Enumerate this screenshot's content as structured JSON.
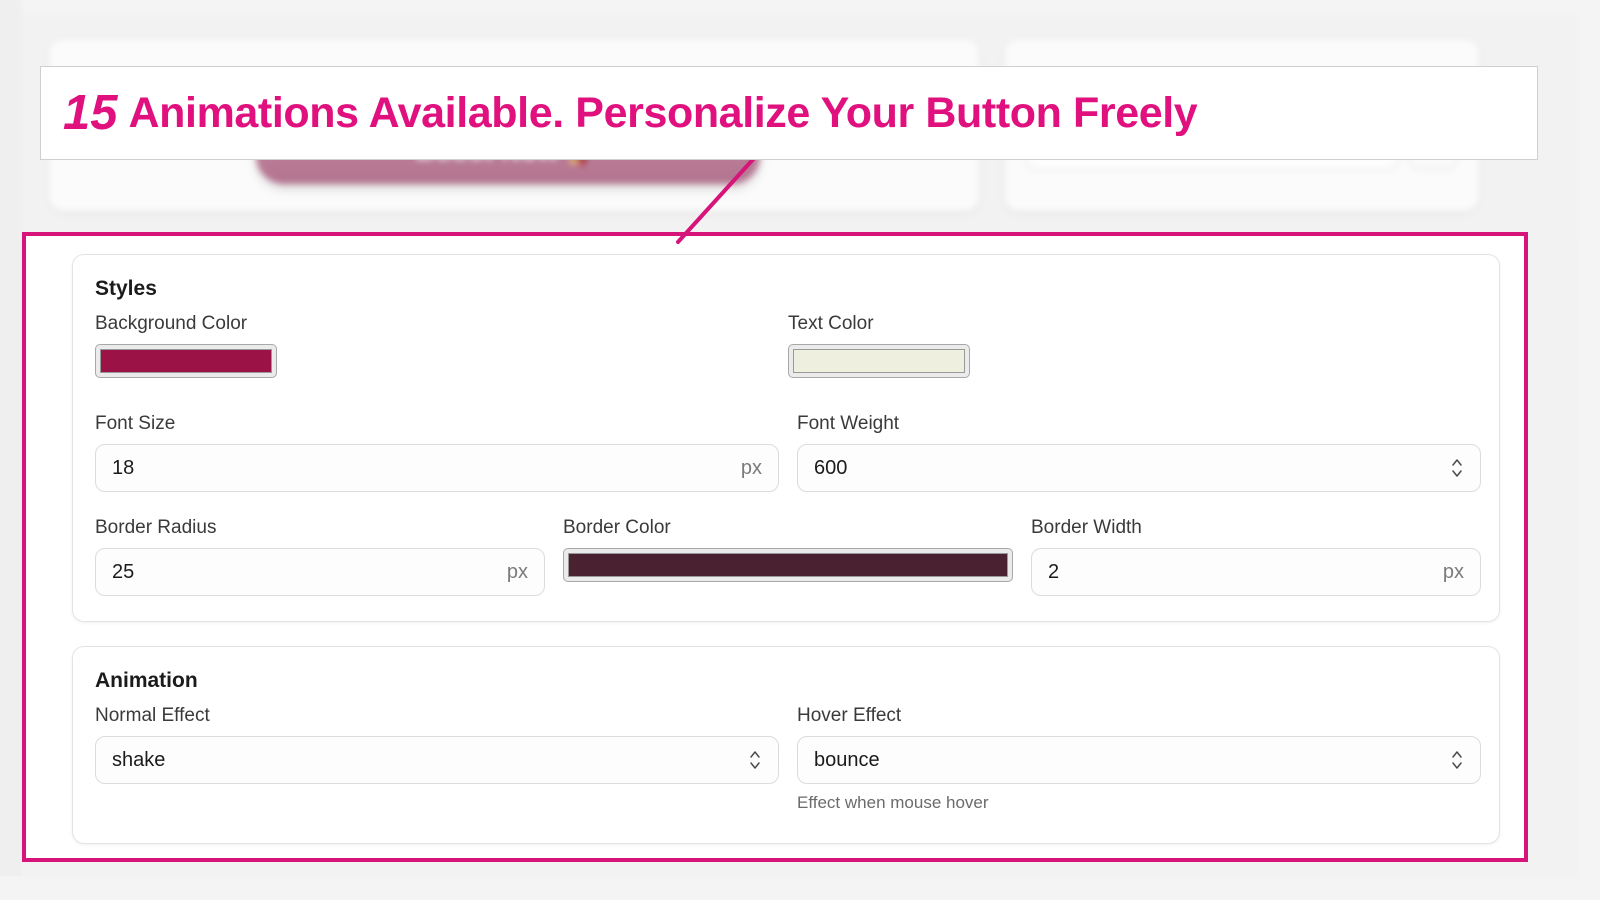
{
  "banner": {
    "number": "15",
    "text": "Animations Available. Personalize Your Button Freely",
    "accent_color": "#e0117e"
  },
  "highlight": {
    "border_color": "#d6147a",
    "arrow_color": "#d6147a"
  },
  "background_app": {
    "preview_button_label": "Boost Now 🚀"
  },
  "styles_card": {
    "title": "Styles",
    "background_color": {
      "label": "Background Color",
      "value": "#9b1246"
    },
    "text_color": {
      "label": "Text Color",
      "value": "#efefdf"
    },
    "font_size": {
      "label": "Font Size",
      "value": "18",
      "suffix": "px"
    },
    "font_weight": {
      "label": "Font Weight",
      "value": "600"
    },
    "border_radius": {
      "label": "Border Radius",
      "value": "25",
      "suffix": "px"
    },
    "border_color": {
      "label": "Border Color",
      "value": "#4a2130"
    },
    "border_width": {
      "label": "Border Width",
      "value": "2",
      "suffix": "px"
    }
  },
  "animation_card": {
    "title": "Animation",
    "normal_effect": {
      "label": "Normal Effect",
      "value": "shake"
    },
    "hover_effect": {
      "label": "Hover Effect",
      "value": "bounce",
      "help": "Effect when mouse hover"
    }
  }
}
